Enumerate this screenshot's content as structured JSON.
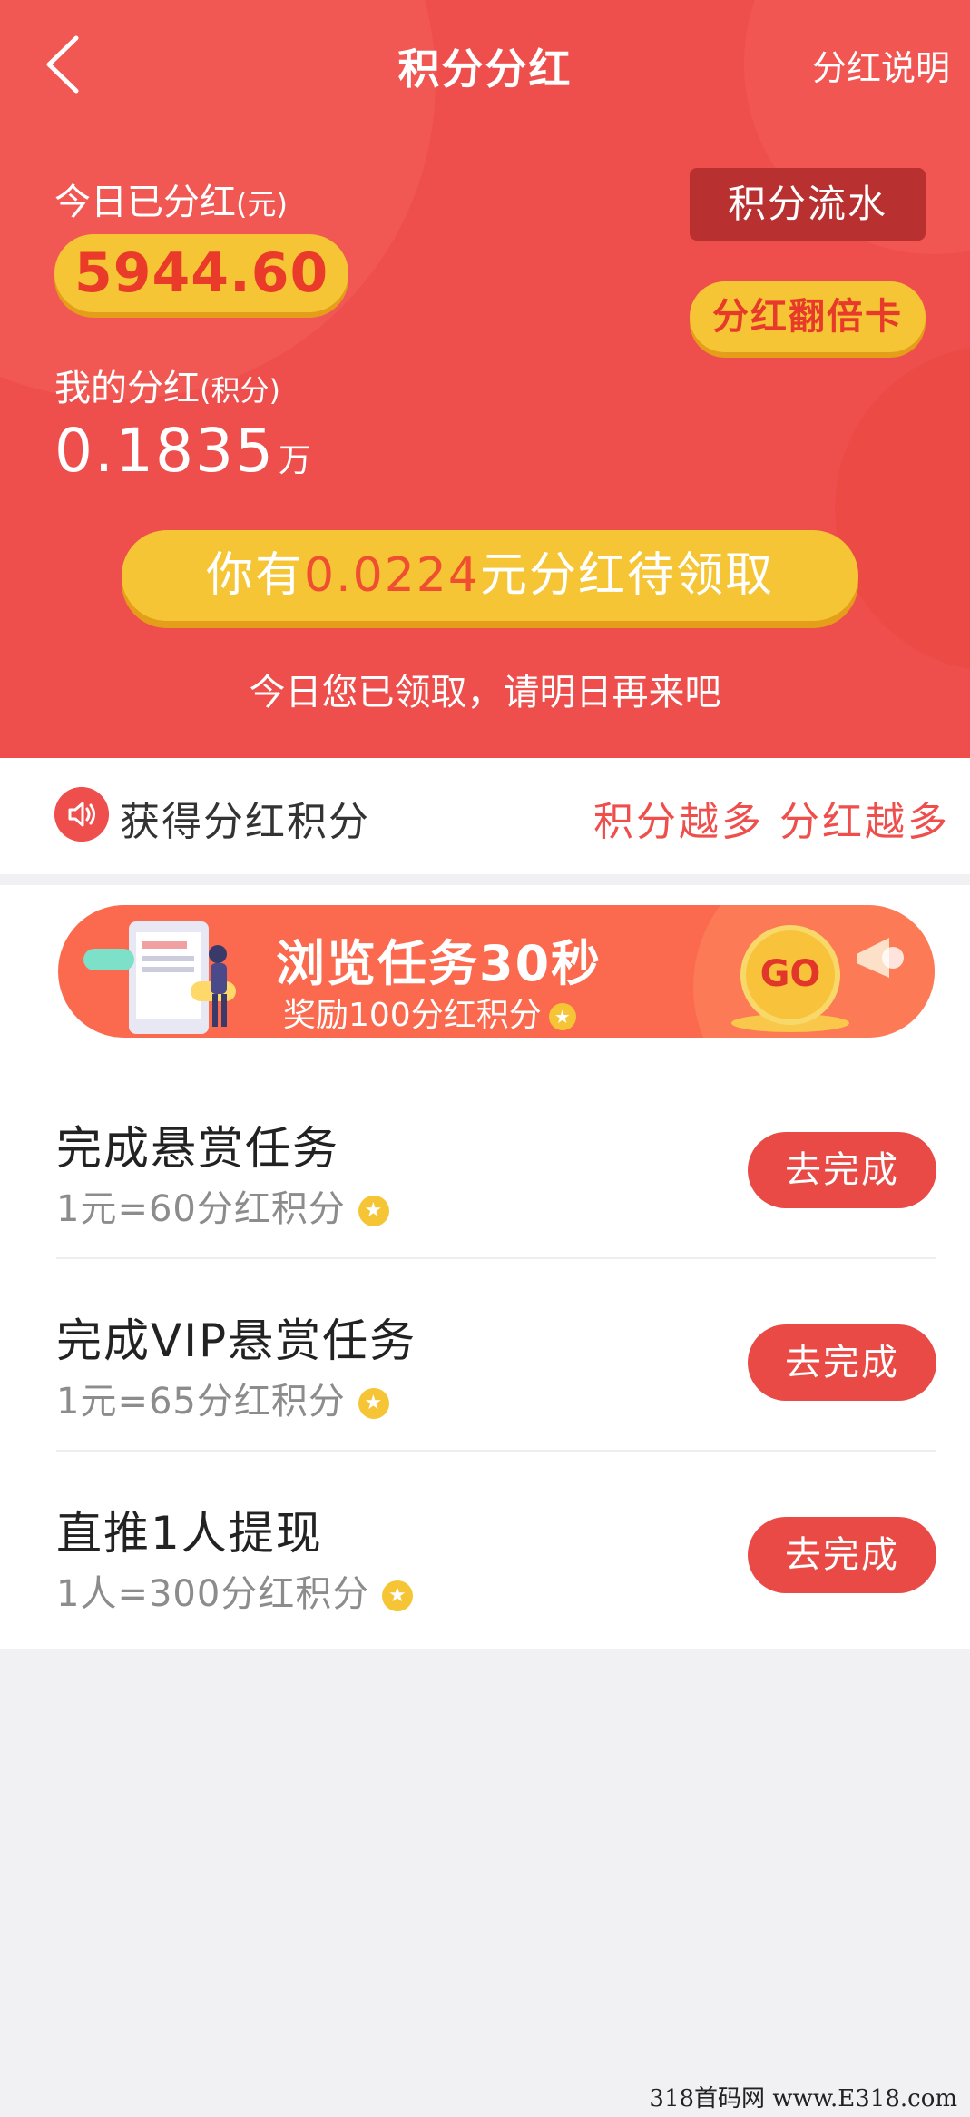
{
  "nav": {
    "title": "积分分红",
    "right_link": "分红说明"
  },
  "hero": {
    "today_label": "今日已分红",
    "today_unit": "(元)",
    "today_amount": "5944.60",
    "mine_label": "我的分红",
    "mine_unit": "(积分)",
    "mine_value": "0.1835",
    "mine_value_unit": "万",
    "flow_button": "积分流水",
    "double_button": "分红翻倍卡",
    "claim_prefix": "你有",
    "claim_amount": "0.0224",
    "claim_suffix": "元分红待领取",
    "claim_note": "今日您已领取，请明日再来吧"
  },
  "notice": {
    "text": "获得分红积分",
    "slogan": "积分越多 分红越多"
  },
  "banner": {
    "title": "浏览任务30秒",
    "subtitle": "奖励100分红积分",
    "go_text": "GO"
  },
  "tasks": [
    {
      "title": "完成悬赏任务",
      "reward": "1元=60分红积分",
      "button": "去完成"
    },
    {
      "title": "完成VIP悬赏任务",
      "reward": "1元=65分红积分",
      "button": "去完成"
    },
    {
      "title": "直推1人提现",
      "reward": "1人=300分红积分",
      "button": "去完成"
    }
  ],
  "watermark": "318首码网 www.E318.com",
  "colors": {
    "primary_red": "#ef4f4c",
    "gold": "#f6c535",
    "dark_red": "#b8302f"
  }
}
